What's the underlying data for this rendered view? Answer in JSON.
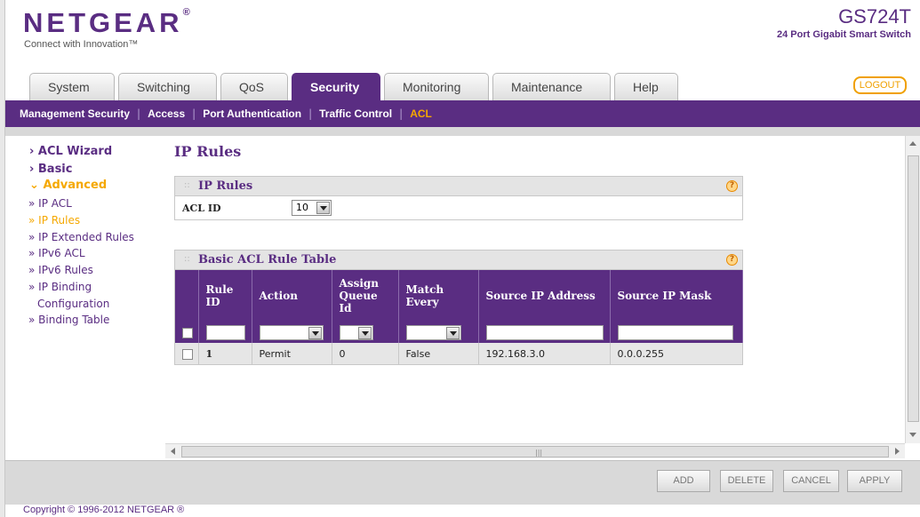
{
  "header": {
    "logo": "NETGEAR",
    "logo_mark": "®",
    "tagline": "Connect with Innovation™",
    "model": "GS724T",
    "model_desc": "24 Port Gigabit Smart Switch",
    "logout": "LOGOUT"
  },
  "tabs": [
    {
      "label": "System"
    },
    {
      "label": "Switching"
    },
    {
      "label": "QoS"
    },
    {
      "label": "Security",
      "active": true
    },
    {
      "label": "Monitoring"
    },
    {
      "label": "Maintenance"
    },
    {
      "label": "Help"
    }
  ],
  "subnav": [
    {
      "label": "Management Security"
    },
    {
      "label": "Access"
    },
    {
      "label": "Port Authentication"
    },
    {
      "label": "Traffic Control"
    },
    {
      "label": "ACL",
      "active": true
    }
  ],
  "sidebar": [
    {
      "label": "ACL Wizard",
      "marker": "›"
    },
    {
      "label": "Basic",
      "marker": "›"
    },
    {
      "label": "Advanced",
      "marker": "⌄",
      "open": true
    },
    {
      "label": "» IP ACL"
    },
    {
      "label": "» IP Rules",
      "current": true
    },
    {
      "label": "» IP Extended Rules"
    },
    {
      "label": "» IPv6 ACL"
    },
    {
      "label": "» IPv6 Rules"
    },
    {
      "label": "» IP Binding"
    },
    {
      "label": "Configuration",
      "indent": true
    },
    {
      "label": "» Binding Table"
    }
  ],
  "main": {
    "title": "IP Rules",
    "ip_rules_box": {
      "title": "IP Rules",
      "acl_label": "ACL ID",
      "acl_value": "10"
    },
    "table_box": {
      "title": "Basic ACL Rule Table",
      "headers": [
        "",
        "Rule ID",
        "Action",
        "Assign Queue Id",
        "Match Every",
        "Source IP Address",
        "Source IP Mask"
      ],
      "rows": [
        {
          "rule_id": "1",
          "action": "Permit",
          "queue": "0",
          "match": "False",
          "source_ip": "192.168.3.0",
          "source_mask": "0.0.0.255"
        }
      ]
    }
  },
  "buttons": {
    "add": "ADD",
    "delete": "DELETE",
    "cancel": "CANCEL",
    "apply": "APPLY"
  },
  "footer": {
    "copyright": "Copyright © 1996-2012 NETGEAR ®"
  },
  "colors": {
    "brand_purple": "#5a2d82",
    "accent_orange": "#f5a800"
  },
  "icons": {
    "help": "help-icon",
    "dropdown": "chevron-down-icon"
  }
}
